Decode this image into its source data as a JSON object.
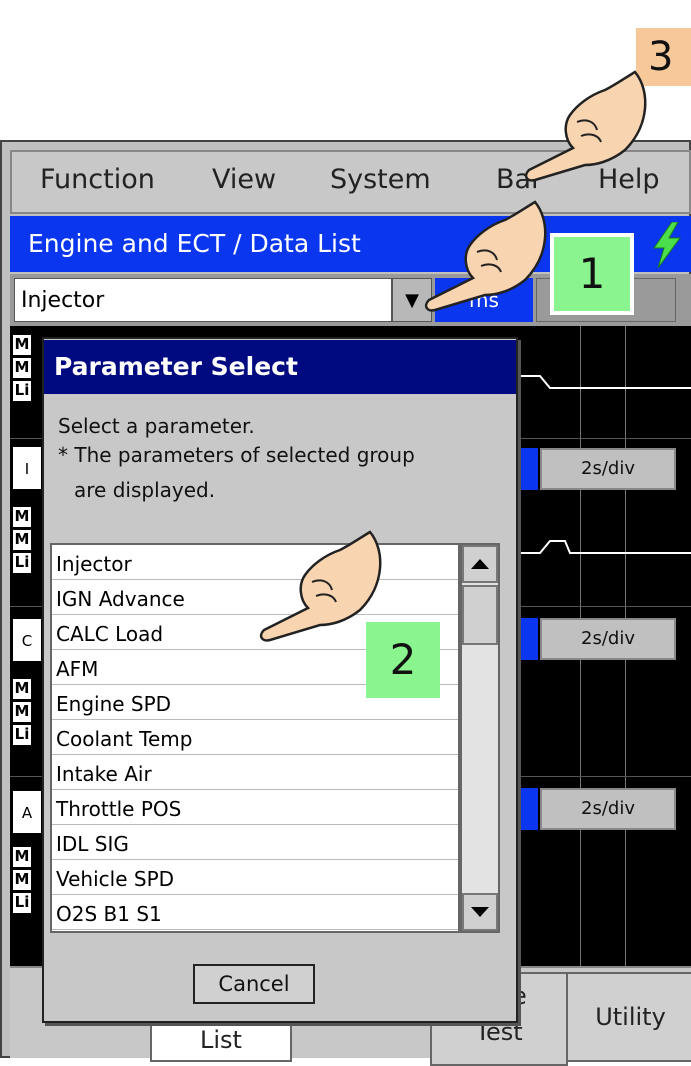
{
  "step_badge": "3",
  "menu": {
    "items": [
      "Function",
      "View",
      "System",
      "Bar",
      "Help"
    ]
  },
  "title_bar": {
    "text": "Engine and ECT / Data List"
  },
  "parameter_row": {
    "selected_value": "Injector",
    "unit_button": "ms"
  },
  "graph": {
    "time_buttons": [
      "2s/div",
      "2s/div",
      "2s/div"
    ],
    "side_labels": [
      "M",
      "M",
      "Li",
      "I",
      "M",
      "M",
      "Li",
      "C",
      "M",
      "M",
      "Li",
      "A",
      "M",
      "M",
      "Li"
    ]
  },
  "dialog": {
    "title": "Parameter Select",
    "message_line1": "Select a parameter.",
    "message_line2": "* The parameters of selected group",
    "message_line3": "are displayed.",
    "items": [
      "Injector",
      "IGN Advance",
      "CALC Load",
      "AFM",
      "Engine SPD",
      "Coolant Temp",
      "Intake Air",
      "Throttle POS",
      "IDL SIG",
      "Vehicle SPD",
      "O2S B1 S1"
    ],
    "cancel_label": "Cancel"
  },
  "tabs": {
    "list_label": "List",
    "active_test_top": "e",
    "active_test_bottom": "Test",
    "utility_label": "Utility"
  },
  "annotations": {
    "badge1": "1",
    "badge2": "2"
  },
  "colors": {
    "title_blue": "#0a36f0",
    "dialog_title": "#000a80",
    "badge_green": "#8af58f",
    "step_orange": "#f7c89a"
  }
}
